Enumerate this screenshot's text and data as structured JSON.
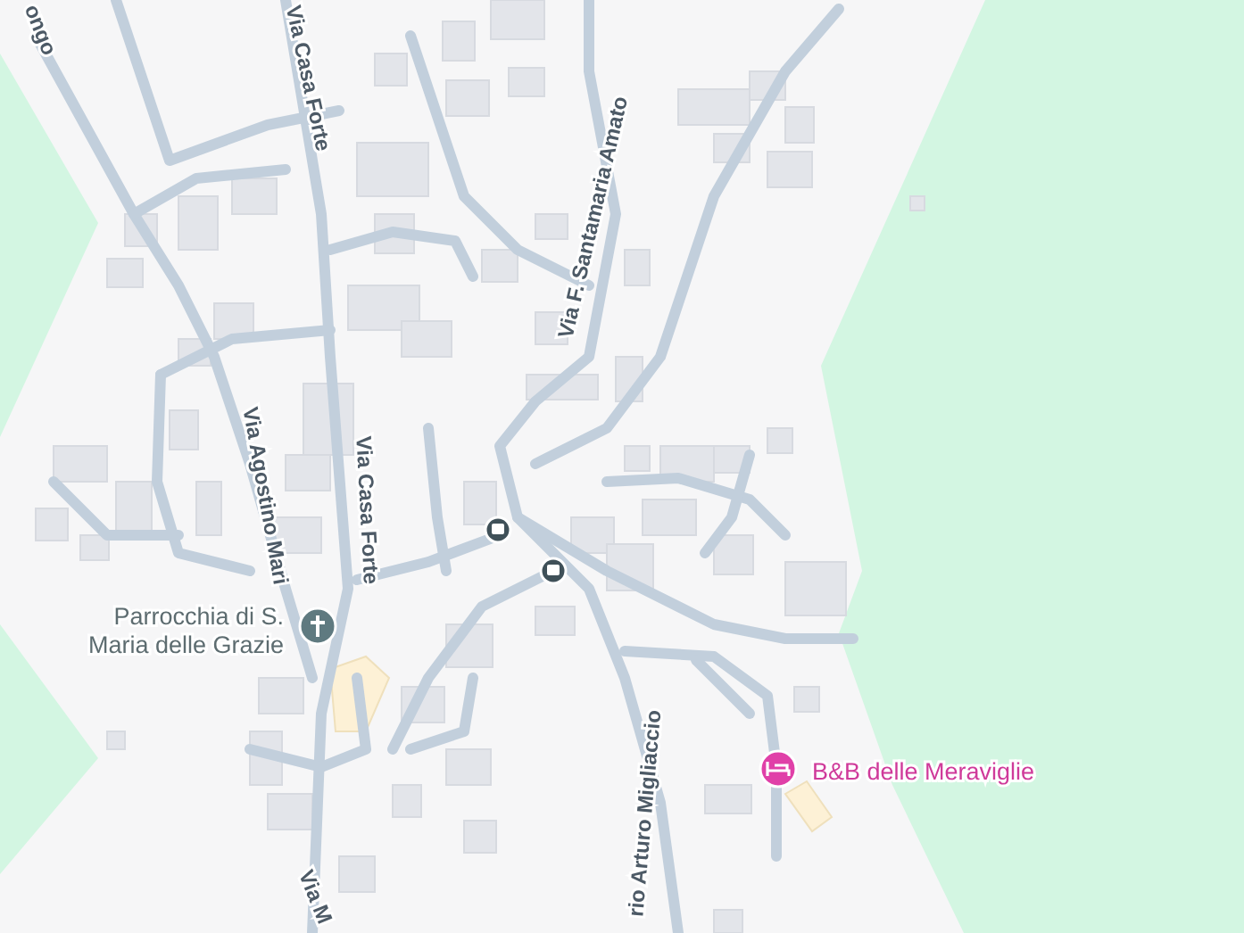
{
  "map": {
    "streets": [
      {
        "name": "ongo"
      },
      {
        "name": "Via Casa Forte"
      },
      {
        "name": "Via F. Santamaria Amato"
      },
      {
        "name": "Via Agostino Mari"
      },
      {
        "name": "Via Casa Forte"
      },
      {
        "name": "rio Arturo Migliaccio"
      },
      {
        "name": "Via M"
      }
    ],
    "places": [
      {
        "kind": "church",
        "lines": [
          "Parrocchia di S.",
          "Maria delle Grazie"
        ],
        "color": "#5f7a80"
      },
      {
        "kind": "lodging",
        "lines": [
          "B&B delle Meraviglie"
        ],
        "color": "#e040a8"
      }
    ]
  }
}
